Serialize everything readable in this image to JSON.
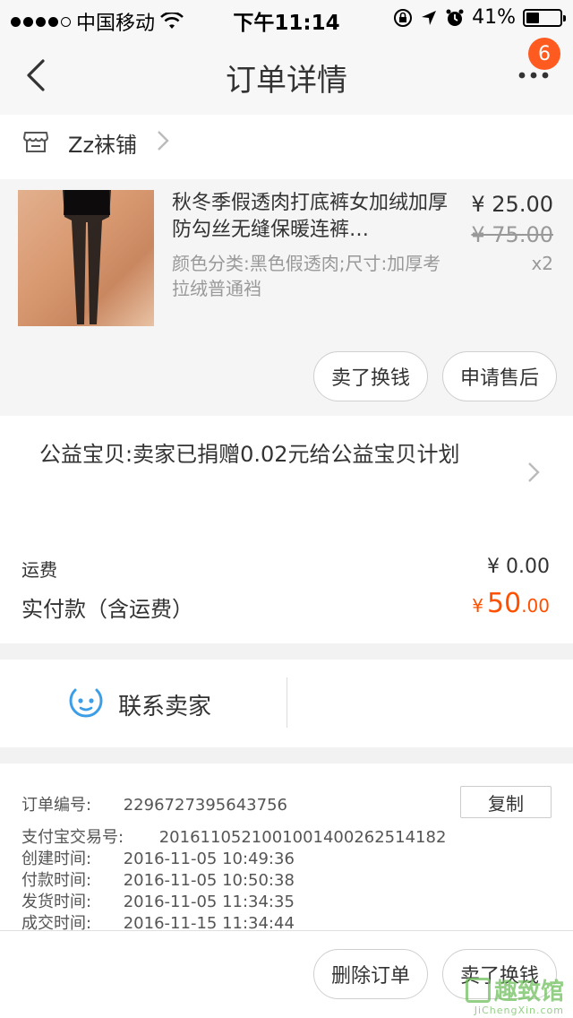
{
  "status_bar": {
    "carrier": "中国移动",
    "time": "下午11:14",
    "battery": "41%"
  },
  "nav": {
    "title": "订单详情",
    "badge": "6"
  },
  "shop": {
    "name": "Zz袜铺"
  },
  "product": {
    "title": "秋冬季假透肉打底裤女加绒加厚防勾丝无缝保暖连裤…",
    "spec": "颜色分类:黑色假透肉;尺寸:加厚考拉绒普通裆",
    "price": "¥ 25.00",
    "original_price": "¥ 75.00",
    "quantity": "x2",
    "buttons": {
      "sell": "卖了换钱",
      "after_sale": "申请售后"
    }
  },
  "charity": {
    "text": "公益宝贝:卖家已捐赠0.02元给公益宝贝计划"
  },
  "fees": {
    "shipping_label": "运费",
    "shipping_value": "¥ 0.00",
    "total_label": "实付款（含运费）",
    "total_symbol": "¥",
    "total_int": "50",
    "total_dec": ".00"
  },
  "contact": {
    "label": "联系卖家"
  },
  "order_info": {
    "copy_button": "复制",
    "rows": [
      {
        "key": "订单编号:",
        "value": "2296727395643756"
      },
      {
        "key": "支付宝交易号:",
        "value": "2016110521001001400262514182"
      },
      {
        "key": "创建时间:",
        "value": "2016-11-05 10:49:36"
      },
      {
        "key": "付款时间:",
        "value": "2016-11-05 10:50:38"
      },
      {
        "key": "发货时间:",
        "value": "2016-11-05 11:34:35"
      },
      {
        "key": "成交时间:",
        "value": "2016-11-15 11:34:44"
      }
    ]
  },
  "bottom_bar": {
    "delete": "删除订单",
    "sell": "卖了换钱"
  },
  "watermark": {
    "main": "趣致馆",
    "sub": "JiChengXin.com"
  },
  "colors": {
    "accent": "#ff5000",
    "badge": "#ff5a1f",
    "contact_icon": "#3b9ee6"
  }
}
